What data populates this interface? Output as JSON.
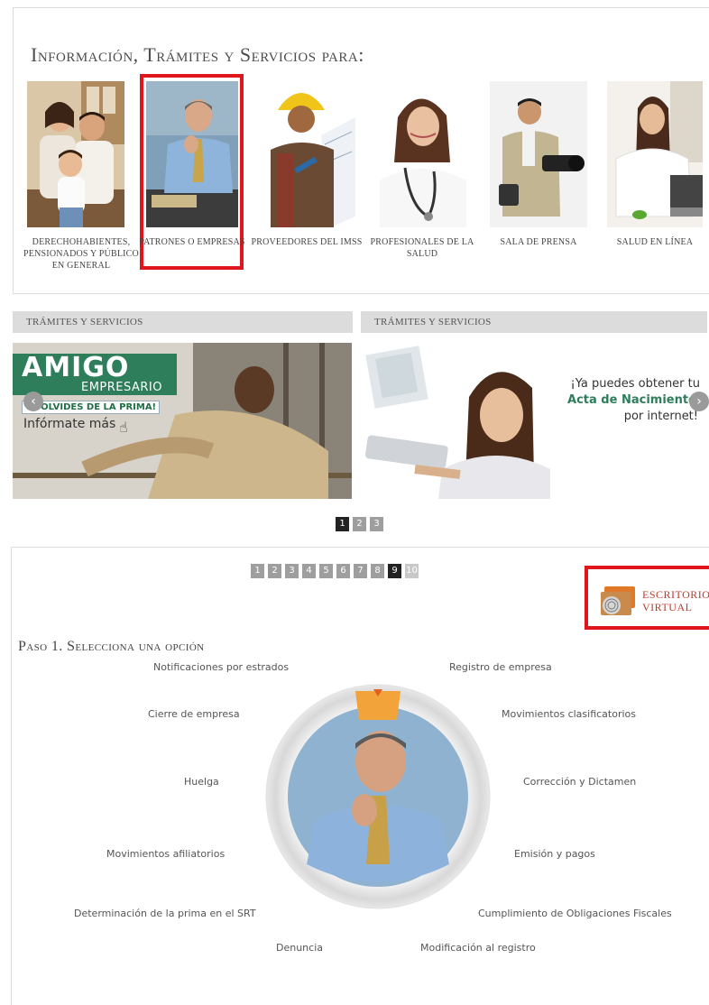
{
  "header": {
    "title": "Información, Trámites y Servicios para:"
  },
  "audiences": [
    {
      "label": "Derechohabientes, pensionados y público en general"
    },
    {
      "label": "Patrones o Empresas"
    },
    {
      "label": "Proveedores del IMSS"
    },
    {
      "label": "Profesionales de la salud"
    },
    {
      "label": "Sala de prensa"
    },
    {
      "label": "Salud en línea"
    }
  ],
  "tramites": {
    "left_title": "Trámites y servicios",
    "right_title": "Trámites y servicios"
  },
  "banner_left": {
    "brand": "AMIGO",
    "brand_sub": "EMPRESARIO",
    "slogan": "TE OLVIDES DE LA PRIMA!",
    "cta": "Infórmate más"
  },
  "banner_right": {
    "line1": "¡Ya puedes obtener tu",
    "line2": "Acta de Nacimiento",
    "line3": "por internet!"
  },
  "carousel_pages": [
    "1",
    "2",
    "3"
  ],
  "carousel_active": "1",
  "step_pages": [
    "1",
    "2",
    "3",
    "4",
    "5",
    "6",
    "7",
    "8",
    "9",
    "10"
  ],
  "step_active": "9",
  "escritorio": {
    "line1": "Escritorio",
    "line2": "Virtual"
  },
  "step": {
    "title": "Paso 1. Selecciona una opción",
    "options": {
      "notificaciones": "Notificaciones por estrados",
      "registro": "Registro de empresa",
      "cierre": "Cierre de empresa",
      "movimientos_clasificatorios": "Movimientos clasificatorios",
      "huelga": "Huelga",
      "correccion": "Corrección y Dictamen",
      "movimientos_afiliatorios": "Movimientos afiliatorios",
      "emision": "Emisión y pagos",
      "determinacion": "Determinación de la prima en el SRT",
      "cumplimiento": "Cumplimiento de Obligaciones Fiscales",
      "denuncia": "Denuncia",
      "modificacion": "Modificación al registro"
    }
  },
  "colors": {
    "highlight": "#e0161d",
    "brand_green": "#2e7d5b",
    "bar_gray": "#dcdcdc",
    "dial_orange": "#f2a33a"
  }
}
